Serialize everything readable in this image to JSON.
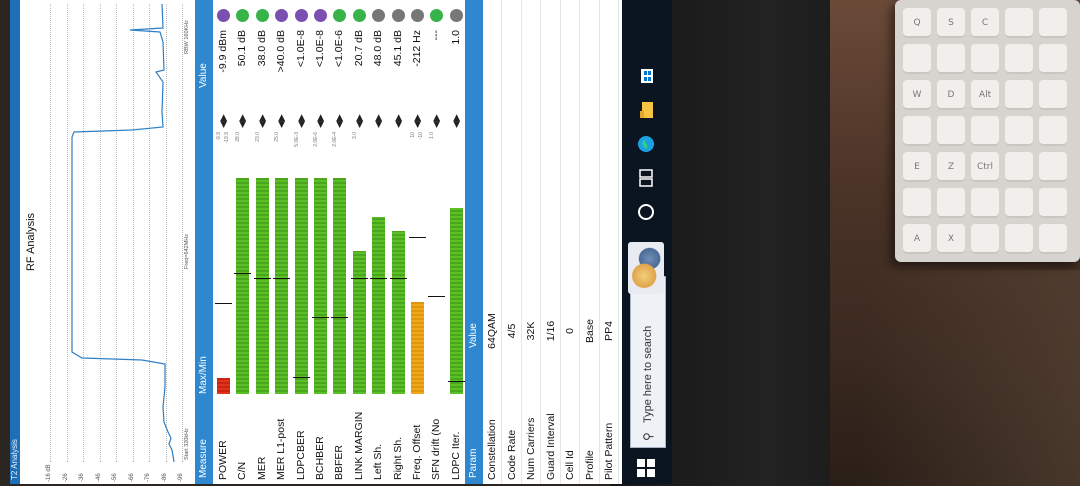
{
  "app": {
    "title": "T2 Analysis",
    "subtitle": "RF Analysis"
  },
  "spectrum": {
    "y_labels": [
      "-16 dB",
      "-26",
      "-36",
      "-46",
      "-56",
      "-66",
      "-76",
      "-86",
      "-96"
    ],
    "start_label": "Start 320kHz",
    "freq_label": "Freq=642MHz",
    "rbw_label": "RBW 160KHz"
  },
  "measure_table": {
    "headers": {
      "measure": "Measure",
      "maxmin": "Max/Min",
      "value": "Value"
    },
    "rows": [
      {
        "label": "POWER",
        "value": "-9.9 dBm",
        "level": 0.07,
        "marker": 0.39,
        "limit_hi": "-9.9",
        "limit_lo": "-19.9",
        "bar_color": "red",
        "dot": "#7a4fb0"
      },
      {
        "label": "C/N",
        "value": "50.1 dB",
        "level": 0.94,
        "marker": 0.52,
        "limit_hi": "28.0",
        "limit_lo": "",
        "bar_color": "green",
        "dot": "#37b34a"
      },
      {
        "label": "MER",
        "value": "38.0 dB",
        "level": 0.94,
        "marker": 0.5,
        "limit_hi": "23.0",
        "limit_lo": "",
        "bar_color": "green",
        "dot": "#37b34a"
      },
      {
        "label": "MER L1-post",
        "value": ">40.0 dB",
        "level": 0.94,
        "marker": 0.5,
        "limit_hi": "25.0",
        "limit_lo": "",
        "bar_color": "green",
        "dot": "#7a4fb0"
      },
      {
        "label": "LDPCBER",
        "value": "<1.0E-8",
        "level": 0.94,
        "marker": 0.07,
        "limit_hi": "5.0E-3",
        "limit_lo": "",
        "bar_color": "green",
        "dot": "#7a4fb0"
      },
      {
        "label": "BCHBER",
        "value": "<1.0E-8",
        "level": 0.94,
        "marker": 0.33,
        "limit_hi": "2.0E-6",
        "limit_lo": "",
        "bar_color": "green",
        "dot": "#7a4fb0"
      },
      {
        "label": "BBFER",
        "value": "<1.0E-6",
        "level": 0.94,
        "marker": 0.33,
        "limit_hi": "2.0E-4",
        "limit_lo": "",
        "bar_color": "green",
        "dot": "#37b34a"
      },
      {
        "label": "LINK MARGIN",
        "value": "20.7 dB",
        "level": 0.62,
        "marker": 0.5,
        "limit_hi": "3.0",
        "limit_lo": "",
        "bar_color": "green",
        "dot": "#37b34a"
      },
      {
        "label": "Left Sh.",
        "value": "48.0 dB",
        "level": 0.77,
        "marker": 0.5,
        "limit_hi": "",
        "limit_lo": "",
        "bar_color": "green",
        "dot": "#777777"
      },
      {
        "label": "Right Sh.",
        "value": "45.1 dB",
        "level": 0.71,
        "marker": 0.5,
        "limit_hi": "",
        "limit_lo": "",
        "bar_color": "green",
        "dot": "#777777"
      },
      {
        "label": "Freq. Offset",
        "value": "-212 Hz",
        "level": 0.4,
        "marker": 0.68,
        "limit_hi": "10",
        "limit_lo": "-10",
        "bar_color": "orange",
        "dot": "#777777"
      },
      {
        "label": "SFN drift (No ref.)",
        "value": "---",
        "level": 0.0,
        "marker": 0.42,
        "limit_hi": "1.0",
        "limit_lo": "",
        "bar_color": "none",
        "dot": "#37b34a"
      },
      {
        "label": "LDPC Iter.",
        "value": "1.0",
        "level": 0.81,
        "marker": 0.05,
        "limit_hi": "",
        "limit_lo": "",
        "bar_color": "green",
        "dot": "#777777"
      }
    ]
  },
  "param_table": {
    "headers": {
      "param": "Param",
      "value": "Value"
    },
    "rows": [
      {
        "label": "Constellation",
        "value": "64QAM"
      },
      {
        "label": "Code Rate",
        "value": "4/5"
      },
      {
        "label": "Num Carriers",
        "value": "32K"
      },
      {
        "label": "Guard Interval",
        "value": "1/16"
      },
      {
        "label": "Cell Id",
        "value": "0"
      },
      {
        "label": "Profile",
        "value": "Base"
      },
      {
        "label": "Pilot Pattern",
        "value": "PP4"
      }
    ]
  },
  "taskbar": {
    "search_placeholder": "Type here to search",
    "icons": [
      "windows-start-icon",
      "search-icon",
      "cortana-icon",
      "task-view-icon",
      "edge-icon",
      "file-explorer-icon",
      "store-icon"
    ]
  },
  "keyboard": {
    "keys": [
      "Q",
      "W",
      "E",
      "A",
      "S",
      "D",
      "Z",
      "X",
      "C",
      "Alt",
      "Ctrl"
    ]
  },
  "colors": {
    "header_blue": "#2f88cf",
    "title_blue": "#1d6fb8",
    "bar_green": "#5bbf28",
    "bar_red": "#e0321e",
    "bar_orange": "#f0a818",
    "taskbar": "#0b1421"
  }
}
